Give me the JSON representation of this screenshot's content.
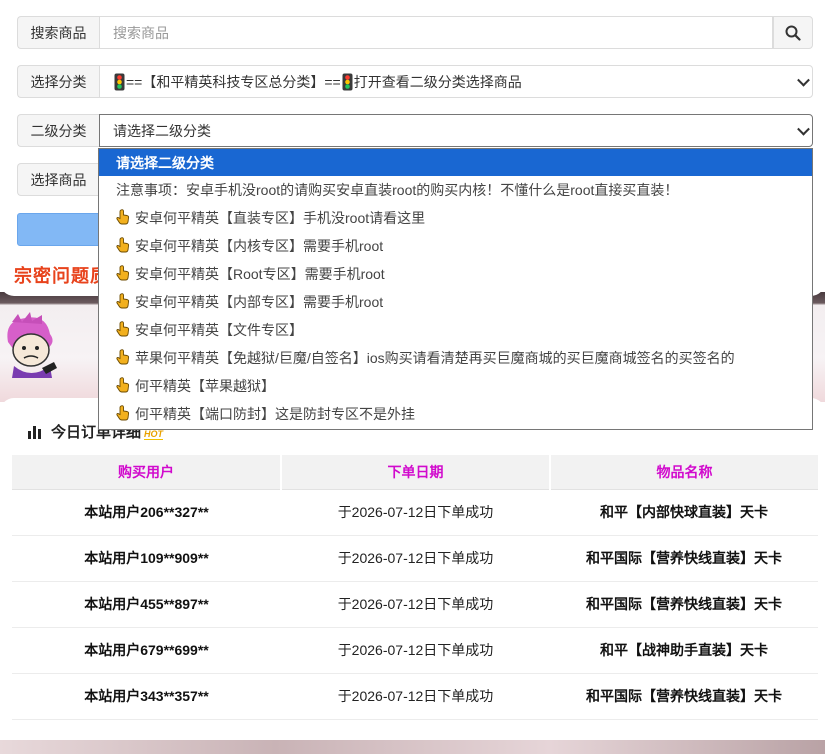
{
  "search": {
    "label": "搜索商品",
    "placeholder": "搜索商品"
  },
  "category": {
    "label": "选择分类",
    "value_prefix": "==【和平精英科技专区总分类】==",
    "value_suffix": "打开查看二级分类选择商品"
  },
  "subcategory": {
    "label": "二级分类",
    "value": "请选择二级分类"
  },
  "product": {
    "label": "选择商品"
  },
  "ticker_text": "宗密问题质",
  "dropdown": {
    "options": [
      {
        "text": "请选择二级分类",
        "selected": true,
        "icon": null
      },
      {
        "text": "注意事项：安卓手机没root的请购买安卓直装root的购买内核！不懂什么是root直接买直装！",
        "selected": false,
        "icon": null
      },
      {
        "text": "安卓何平精英【直装专区】手机没root请看这里",
        "selected": false,
        "icon": "hand-pointer-icon"
      },
      {
        "text": "安卓何平精英【内核专区】需要手机root",
        "selected": false,
        "icon": "hand-pointer-icon"
      },
      {
        "text": "安卓何平精英【Root专区】需要手机root",
        "selected": false,
        "icon": "hand-pointer-icon"
      },
      {
        "text": "安卓何平精英【内部专区】需要手机root",
        "selected": false,
        "icon": "hand-pointer-icon"
      },
      {
        "text": "安卓何平精英【文件专区】",
        "selected": false,
        "icon": "hand-pointer-icon"
      },
      {
        "text": "苹果何平精英【免越狱/巨魔/自签名】ios购买请看清楚再买巨魔商城的买巨魔商城签名的买签名的",
        "selected": false,
        "icon": "hand-pointer-icon"
      },
      {
        "text": "何平精英【苹果越狱】",
        "selected": false,
        "icon": "hand-pointer-icon"
      },
      {
        "text": "何平精英【端口防封】这是防封专区不是外挂",
        "selected": false,
        "icon": "hand-pointer-icon"
      }
    ]
  },
  "orders": {
    "title": "今日订单详细",
    "hot_badge": "HOT",
    "columns": [
      "购买用户",
      "下单日期",
      "物品名称"
    ],
    "rows": [
      [
        "本站用户206**327**",
        "于2026-07-12日下单成功",
        "和平【内部快球直装】天卡"
      ],
      [
        "本站用户109**909**",
        "于2026-07-12日下单成功",
        "和平国际【营养快线直装】天卡"
      ],
      [
        "本站用户455**897**",
        "于2026-07-12日下单成功",
        "和平国际【营养快线直装】天卡"
      ],
      [
        "本站用户679**699**",
        "于2026-07-12日下单成功",
        "和平【战神助手直装】天卡"
      ],
      [
        "本站用户343**357**",
        "于2026-07-12日下单成功",
        "和平国际【营养快线直装】天卡"
      ]
    ]
  },
  "colors": {
    "accent_blue": "#1967d2",
    "header_magenta": "#d10acd",
    "ticker_orange": "#e8431c"
  }
}
